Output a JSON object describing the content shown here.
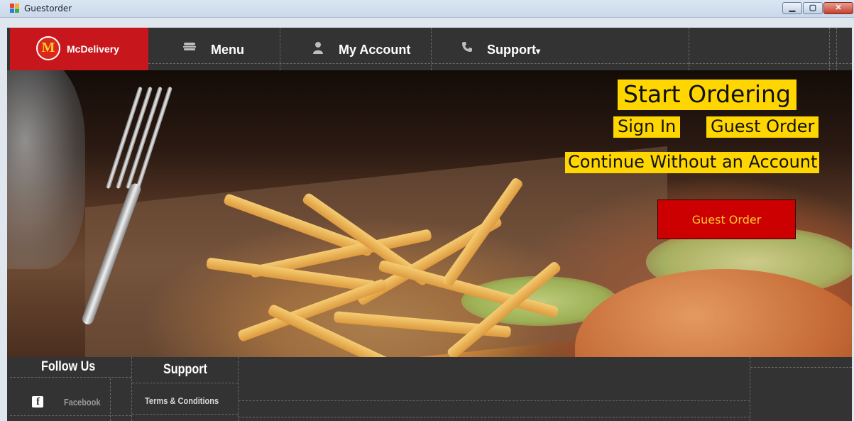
{
  "window": {
    "title": "Guestorder"
  },
  "nav": {
    "brand": "McDelivery",
    "logo_letter": "M",
    "items": [
      {
        "label": "Menu",
        "icon": "burger-icon"
      },
      {
        "label": "My Account",
        "icon": "user-icon"
      },
      {
        "label": "Support",
        "icon": "phone-icon",
        "caret": "▾"
      }
    ]
  },
  "hero": {
    "heading": "Start Ordering",
    "sign_in": "Sign In",
    "guest_order_link": "Guest Order",
    "continue_text": "Continue Without an Account",
    "guest_order_button": "Guest Order"
  },
  "footer": {
    "follow_title": "Follow Us",
    "facebook_label": "Facebook",
    "support_title": "Support",
    "terms_label": "Terms & Conditions"
  },
  "colors": {
    "brand_red": "#c8161d",
    "nav_bg": "#333333",
    "highlight_yellow": "#ffd600",
    "button_red": "#cc0000",
    "button_text": "#ffc72c"
  }
}
